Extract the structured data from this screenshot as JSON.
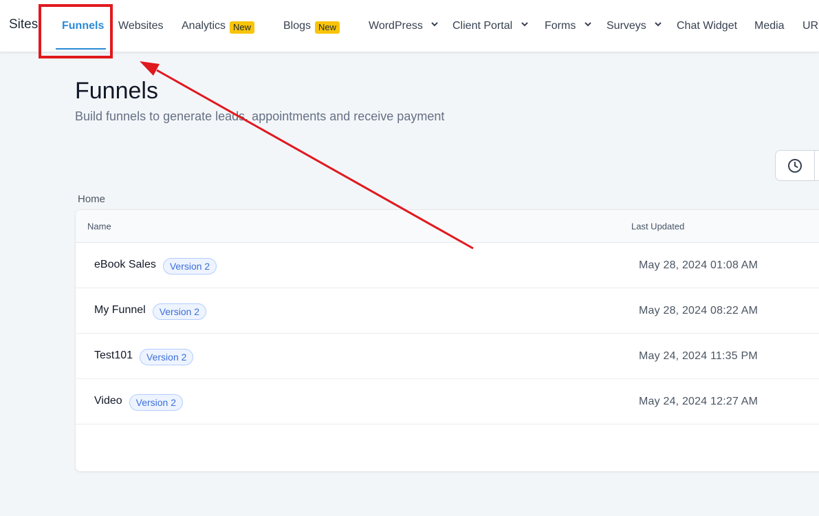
{
  "nav": {
    "app_title": "Sites",
    "items": [
      {
        "label": "Funnels",
        "active": true
      },
      {
        "label": "Websites"
      },
      {
        "label": "Analytics",
        "badge": "New"
      },
      {
        "label": "Blogs",
        "badge": "New"
      },
      {
        "label": "WordPress",
        "dropdown": true
      },
      {
        "label": "Client Portal",
        "dropdown": true
      },
      {
        "label": "Forms",
        "dropdown": true
      },
      {
        "label": "Surveys",
        "dropdown": true
      },
      {
        "label": "Chat Widget"
      },
      {
        "label": "Media"
      },
      {
        "label": "URL"
      }
    ]
  },
  "header": {
    "title": "Funnels",
    "subtitle": "Build funnels to generate leads, appointments and receive payment"
  },
  "toolbar": {
    "history_icon": "clock-icon"
  },
  "breadcrumb": {
    "label": "Home"
  },
  "table": {
    "columns": [
      "Name",
      "Last Updated"
    ],
    "rows": [
      {
        "name": "eBook Sales",
        "badge": "Version 2",
        "updated": "May 28, 2024 01:08 AM"
      },
      {
        "name": "My Funnel",
        "badge": "Version 2",
        "updated": "May 28, 2024 08:22 AM"
      },
      {
        "name": "Test101",
        "badge": "Version 2",
        "updated": "May 24, 2024 11:35 PM"
      },
      {
        "name": "Video",
        "badge": "Version 2",
        "updated": "May 24, 2024 12:27 AM"
      }
    ]
  },
  "colors": {
    "accent": "#2b8ad8",
    "badge_new": "#f9c409",
    "annotation": "#e0191e",
    "version_badge_text": "#3b6fd8"
  }
}
